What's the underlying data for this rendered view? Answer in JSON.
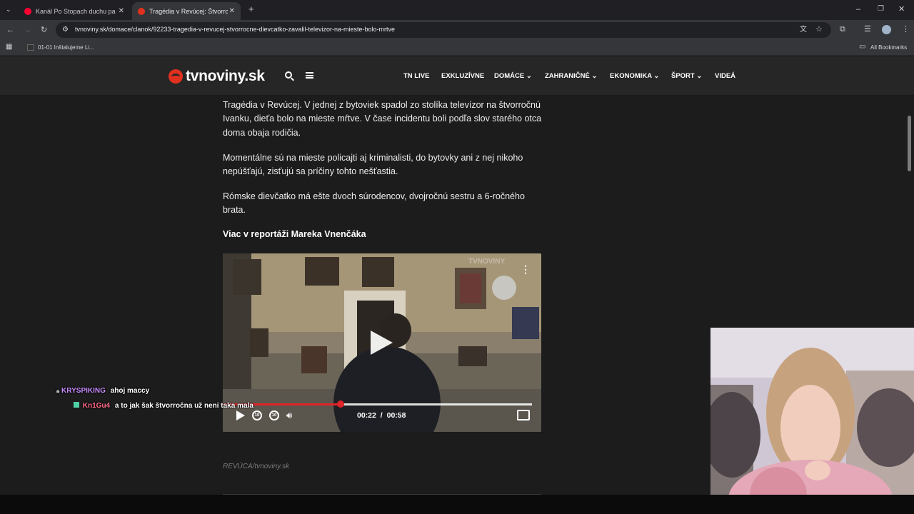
{
  "browser": {
    "tabs": [
      {
        "title": "Kanál Po Stopach duchu paranormal",
        "active": false
      },
      {
        "title": "Tragédia v Revúcej: Štvorročné dievčatko",
        "active": true
      }
    ],
    "url": "tvnoviny.sk/domace/clanok/92233-tragedia-v-revucej-stvorrocne-dievcatko-zavalil-televizor-na-mieste-bolo-mrtve",
    "bookmarks": {
      "item": "01-01 Inštalujeme Li...",
      "all_bookmarks": "All Bookmarks"
    }
  },
  "site": {
    "logo": "tvnoviny.sk",
    "nav": [
      {
        "label": "TN LIVE",
        "dropdown": false
      },
      {
        "label": "EXKLUZÍVNE",
        "dropdown": false
      },
      {
        "label": "DOMÁCE",
        "dropdown": true
      },
      {
        "label": "ZAHRANIČNÉ",
        "dropdown": true
      },
      {
        "label": "EKONOMIKA",
        "dropdown": true
      },
      {
        "label": "ŠPORT",
        "dropdown": true
      },
      {
        "label": "VIDEÁ",
        "dropdown": false
      }
    ]
  },
  "article": {
    "paragraphs": [
      "Tragédia v Revúcej. V jednej z bytoviek spadol zo stolíka televízor na štvorročnú Ivanku, dieťa bolo na mieste mŕtve. V čase incidentu boli podľa slov starého otca doma obaja rodičia.",
      "Momentálne sú na mieste policajti aj kriminalisti, do bytovky ani z nej nikoho nepúšťajú, zisťujú sa príčiny tohto nešťastia.",
      "Rómske dievčatko má ešte dvoch súrodencov, dvojročnú sestru a 6-ročného brata."
    ],
    "subheading": "Viac v reportáži Mareka Vnenčáka",
    "caption": "REVÚCA/tvnoviny.sk"
  },
  "video": {
    "watermark": "TVNOVINY",
    "current_time": "00:22",
    "duration": "00:58",
    "time_separator": "/",
    "progress_fraction": 0.379
  },
  "chat": [
    {
      "user": "KRYSPIKING",
      "message": "ahoj maccy",
      "user_color": "#c98cff"
    },
    {
      "user": "Kn1Gu4",
      "message": "a to jak šak štvorročna už neni taka mala",
      "user_color": "#ff6b8a"
    }
  ],
  "colors": {
    "brand_red": "#e0311f",
    "progress_red": "#e0242a",
    "page_bg": "#1c1c1c",
    "header_bg": "#262626"
  }
}
